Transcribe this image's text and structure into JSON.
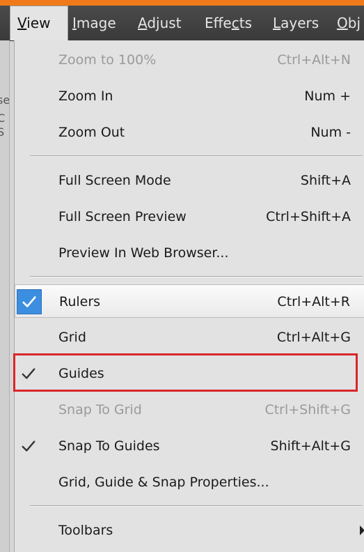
{
  "menubar": {
    "items": [
      {
        "label": "View",
        "underline": "V",
        "active": true
      },
      {
        "label": "Image",
        "underline": "I"
      },
      {
        "label": "Adjust",
        "underline": "A"
      },
      {
        "label": "Effects",
        "underline": "c"
      },
      {
        "label": "Layers",
        "underline": "L"
      },
      {
        "label": "Obj",
        "underline": "O"
      }
    ]
  },
  "left_strip": {
    "fragments": [
      "se",
      "C",
      "S"
    ]
  },
  "menu": {
    "items": [
      {
        "label": "Zoom to 100%",
        "shortcut": "Ctrl+Alt+N",
        "disabled": true
      },
      {
        "label": "Zoom In",
        "shortcut": "Num +"
      },
      {
        "label": "Zoom Out",
        "shortcut": "Num -"
      },
      {
        "label": "Full Screen Mode",
        "shortcut": "Shift+A"
      },
      {
        "label": "Full Screen Preview",
        "shortcut": "Ctrl+Shift+A"
      },
      {
        "label": "Preview In Web Browser...",
        "shortcut": ""
      },
      {
        "label": "Rulers",
        "shortcut": "Ctrl+Alt+R",
        "checked": true
      },
      {
        "label": "Grid",
        "shortcut": "Ctrl+Alt+G"
      },
      {
        "label": "Guides",
        "shortcut": "",
        "checked": true
      },
      {
        "label": "Snap To Grid",
        "shortcut": "Ctrl+Shift+G",
        "disabled": true
      },
      {
        "label": "Snap To Guides",
        "shortcut": "Shift+Alt+G",
        "checked": true
      },
      {
        "label": "Grid, Guide & Snap Properties...",
        "shortcut": ""
      },
      {
        "label": "Toolbars",
        "shortcut": "",
        "submenu": true
      }
    ]
  },
  "icons": {
    "checkmark": "checkmark-icon",
    "submenu_arrow": "chevron-right-icon"
  },
  "colors": {
    "accent_orange": "#f07a1a",
    "checked_blue": "#3b8ee0",
    "highlight_red": "#d9262a"
  }
}
